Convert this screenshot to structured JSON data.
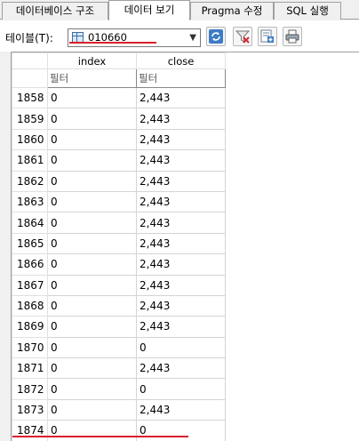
{
  "tabs": [
    {
      "label": "데이터베이스 구조",
      "active": false
    },
    {
      "label": "데이터 보기",
      "active": true
    },
    {
      "label": "Pragma 수정",
      "active": false
    },
    {
      "label": "SQL 실행",
      "active": false
    }
  ],
  "table_selector": {
    "label": "테이블(T):",
    "value": "010660"
  },
  "toolbar_icons": [
    "refresh-icon",
    "clear-filter-icon",
    "new-record-icon",
    "print-icon"
  ],
  "grid": {
    "columns": [
      "index",
      "close"
    ],
    "filter_placeholders": [
      "필터",
      "필터"
    ],
    "rows": [
      {
        "rownum": "1858",
        "index": "0",
        "close": "2,443"
      },
      {
        "rownum": "1859",
        "index": "0",
        "close": "2,443"
      },
      {
        "rownum": "1860",
        "index": "0",
        "close": "2,443"
      },
      {
        "rownum": "1861",
        "index": "0",
        "close": "2,443"
      },
      {
        "rownum": "1862",
        "index": "0",
        "close": "2,443"
      },
      {
        "rownum": "1863",
        "index": "0",
        "close": "2,443"
      },
      {
        "rownum": "1864",
        "index": "0",
        "close": "2,443"
      },
      {
        "rownum": "1865",
        "index": "0",
        "close": "2,443"
      },
      {
        "rownum": "1866",
        "index": "0",
        "close": "2,443"
      },
      {
        "rownum": "1867",
        "index": "0",
        "close": "2,443"
      },
      {
        "rownum": "1868",
        "index": "0",
        "close": "2,443"
      },
      {
        "rownum": "1869",
        "index": "0",
        "close": "2,443"
      },
      {
        "rownum": "1870",
        "index": "0",
        "close": "0"
      },
      {
        "rownum": "1871",
        "index": "0",
        "close": "2,443"
      },
      {
        "rownum": "1872",
        "index": "0",
        "close": "0"
      },
      {
        "rownum": "1873",
        "index": "0",
        "close": "2,443"
      },
      {
        "rownum": "1874",
        "index": "0",
        "close": "0"
      }
    ]
  },
  "colors": {
    "highlight_underline": "#d8202a"
  }
}
